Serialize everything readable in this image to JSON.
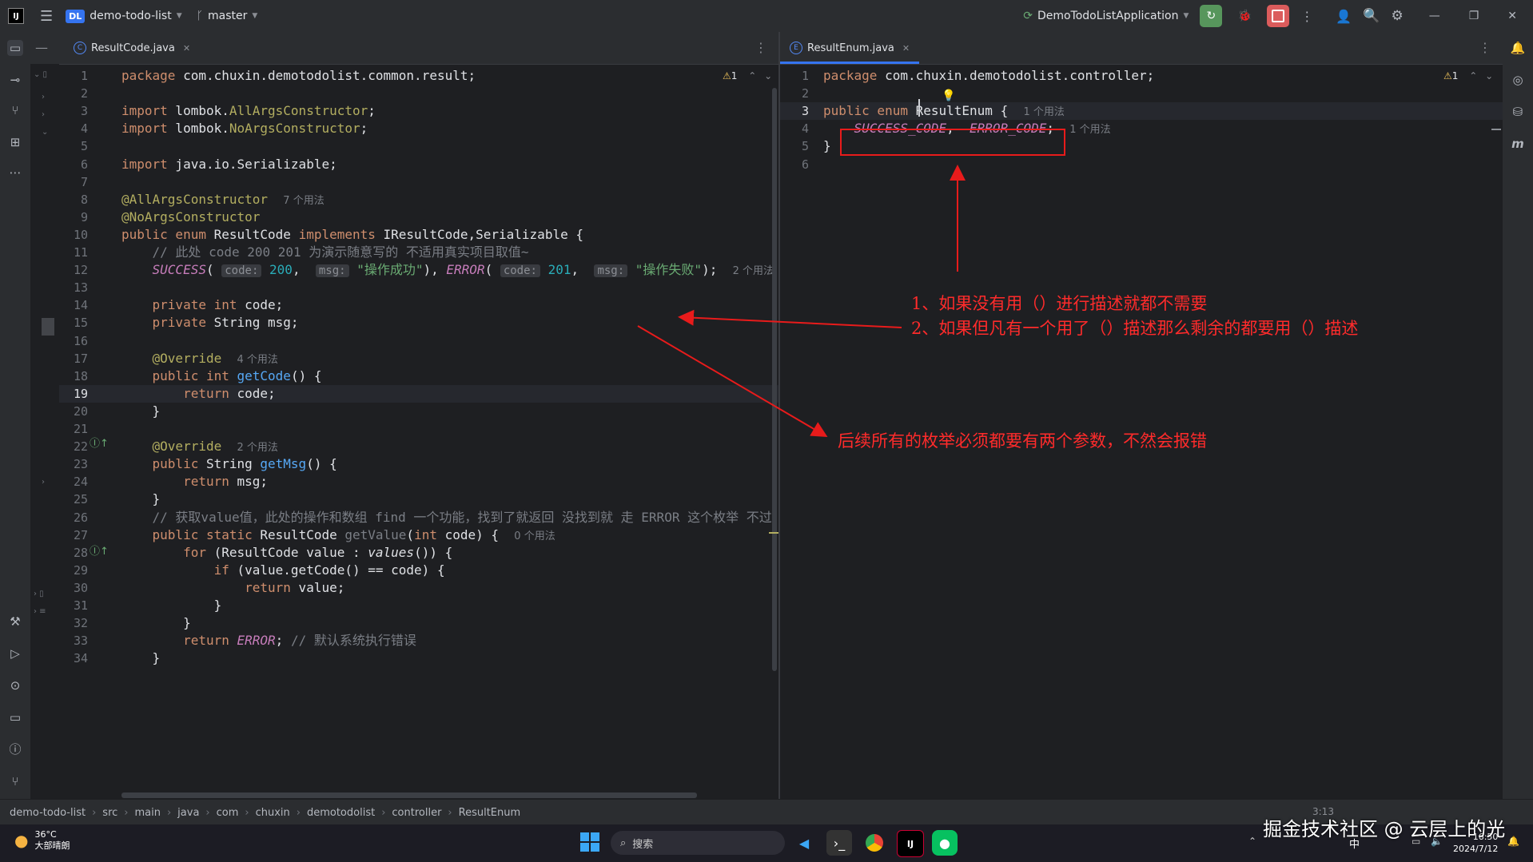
{
  "titlebar": {
    "project_badge": "DL",
    "project_name": "demo-todo-list",
    "branch": "master",
    "run_config": "DemoTodoListApplication"
  },
  "left_editor": {
    "tab_label": "ResultCode.java",
    "warning_count": "1",
    "lines": [
      {
        "n": "1",
        "html": "<span class='kw'>package</span> com.chuxin.demotodolist.common.result;"
      },
      {
        "n": "2",
        "html": ""
      },
      {
        "n": "3",
        "html": "<span class='kw'>import</span> lombok.<span class='ann'>AllArgsConstructor</span>;"
      },
      {
        "n": "4",
        "html": "<span class='kw'>import</span> lombok.<span class='ann'>NoArgsConstructor</span>;"
      },
      {
        "n": "5",
        "html": ""
      },
      {
        "n": "6",
        "html": "<span class='kw'>import</span> java.io.Serializable;"
      },
      {
        "n": "7",
        "html": ""
      },
      {
        "n": "8",
        "html": "<span class='ann'>@AllArgsConstructor</span>  <span class='hint'>7 个用法</span>"
      },
      {
        "n": "9",
        "html": "<span class='ann'>@NoArgsConstructor</span>"
      },
      {
        "n": "10",
        "html": "<span class='kw'>public enum</span> ResultCode <span class='kw'>implements</span> IResultCode,Serializable {"
      },
      {
        "n": "11",
        "html": "    <span class='cm'>// 此处 code 200 201 为演示随意写的 不适用真实项目取值~</span>"
      },
      {
        "n": "12",
        "html": "    <span class='en'>SUCCESS</span>( <span class='inlay'>code:</span> <span class='num'>200</span>,  <span class='inlay'>msg:</span> <span class='str'>\"操作成功\"</span>), <span class='en'>ERROR</span>( <span class='inlay'>code:</span> <span class='num'>201</span>,  <span class='inlay'>msg:</span> <span class='str'>\"操作失败\"</span>);  <span class='hint'>2 个用法</span>"
      },
      {
        "n": "13",
        "html": ""
      },
      {
        "n": "14",
        "html": "    <span class='kw'>private int</span> code;"
      },
      {
        "n": "15",
        "html": "    <span class='kw'>private</span> String msg;"
      },
      {
        "n": "16",
        "html": ""
      },
      {
        "n": "17",
        "html": "    <span class='ann'>@Override</span>  <span class='hint'>4 个用法</span>"
      },
      {
        "n": "18",
        "html": "    <span class='kw'>public int</span> <span class='fn'>getCode</span>() {"
      },
      {
        "n": "19",
        "html": "        <span class='kw'>return</span> code;"
      },
      {
        "n": "20",
        "html": "    }"
      },
      {
        "n": "21",
        "html": ""
      },
      {
        "n": "22",
        "html": "    <span class='ann'>@Override</span>  <span class='hint'>2 个用法</span>"
      },
      {
        "n": "23",
        "html": "    <span class='kw'>public</span> String <span class='fn'>getMsg</span>() {"
      },
      {
        "n": "24",
        "html": "        <span class='kw'>return</span> msg;"
      },
      {
        "n": "25",
        "html": "    }"
      },
      {
        "n": "26",
        "html": "    <span class='cm'>// 获取value值，此处的操作和数组 find 一个功能，找到了就返回 没找到就 走 ERROR 这个枚举 不过</span>"
      },
      {
        "n": "27",
        "html": "    <span class='kw'>public static</span> ResultCode <span class='cm'>getValue</span>(<span class='kw'>int</span> code) {  <span class='hint'>0 个用法</span>"
      },
      {
        "n": "28",
        "html": "        <span class='kw'>for</span> (ResultCode value : <span class='it'>values</span>()) {"
      },
      {
        "n": "29",
        "html": "            <span class='kw'>if</span> (value.getCode() == code) {"
      },
      {
        "n": "30",
        "html": "                <span class='kw'>return</span> value;"
      },
      {
        "n": "31",
        "html": "            }"
      },
      {
        "n": "32",
        "html": "        }"
      },
      {
        "n": "33",
        "html": "        <span class='kw'>return</span> <span class='en'>ERROR</span>; <span class='cm'>// 默认系统执行错误</span>"
      },
      {
        "n": "34",
        "html": "    }"
      }
    ]
  },
  "right_editor": {
    "tab_label": "ResultEnum.java",
    "warning_count": "1",
    "lines": [
      {
        "n": "1",
        "html": "<span class='kw'>package</span> com.chuxin.demotodolist.controller;"
      },
      {
        "n": "2",
        "html": ""
      },
      {
        "n": "3",
        "html": "<span class='kw'>public enum</span> ResultEnum {  <span class='hint'>1 个用法</span>"
      },
      {
        "n": "4",
        "html": "    <span class='en'>SUCCESS_CODE</span>,  <span class='en'>ERROR_CODE</span>;  <span class='hint'>1 个用法</span>"
      },
      {
        "n": "5",
        "html": "}"
      },
      {
        "n": "6",
        "html": ""
      }
    ]
  },
  "annotations": {
    "note1": "1、如果没有用（）进行描述就都不需要",
    "note2": "2、如果但凡有一个用了（）描述那么剩余的都要用（）描述",
    "note3": "后续所有的枚举必须都要有两个参数，不然会报错"
  },
  "statusbar": {
    "crumbs": [
      "demo-todo-list",
      "src",
      "main",
      "java",
      "com",
      "chuxin",
      "demotodolist",
      "controller",
      "ResultEnum"
    ],
    "position": "3:13"
  },
  "taskbar": {
    "weather_temp": "36°C",
    "weather_desc": "大部晴朗",
    "search_label": "搜索",
    "ime_label": "中",
    "clock_time": "16:50",
    "clock_date": "2024/7/12"
  },
  "watermark": "掘金技术社区 @ 云层上的光"
}
